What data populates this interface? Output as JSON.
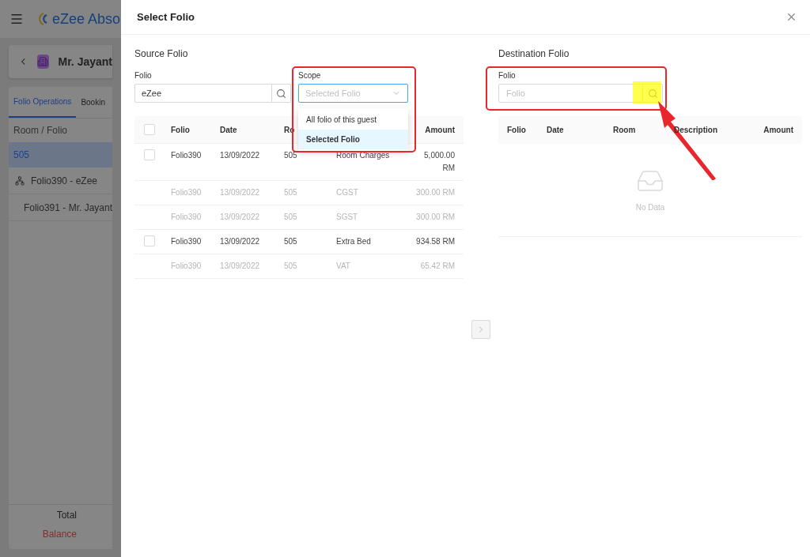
{
  "app": {
    "logo_text": "eZee Abso",
    "guest_name": "Mr. Jayant",
    "tabs": [
      {
        "label": "Folio Operations",
        "selected": true
      },
      {
        "label": "Bookin",
        "selected": false
      }
    ],
    "list_header": "Room / Folio",
    "rooms": [
      {
        "label": "505",
        "selected": true,
        "children": [
          {
            "label": "Folio390 - eZee",
            "kind": "linked"
          },
          {
            "label": "Folio391 - Mr. Jayant",
            "kind": "plain"
          }
        ]
      }
    ],
    "totals": [
      {
        "label": "Total",
        "kind": "normal"
      },
      {
        "label": "Balance",
        "kind": "alert"
      }
    ]
  },
  "dialog": {
    "title": "Select Folio",
    "source": {
      "heading": "Source Folio",
      "folio_field": {
        "label": "Folio",
        "value": "eZee"
      },
      "scope": {
        "label": "Scope",
        "placeholder": "Selected Folio",
        "expanded": true,
        "options": [
          {
            "label": "All folio of this guest",
            "selected": false
          },
          {
            "label": "Selected Folio",
            "selected": true
          }
        ]
      },
      "select_all_checked": false,
      "columns": {
        "folio": "Folio",
        "date": "Date",
        "room": "Ro",
        "amount": "Amount"
      },
      "rows": [
        {
          "folio": "Folio390",
          "date": "13/09/2022",
          "room": "505",
          "description": "Room Charges",
          "amount": "5,000.00 RM",
          "selectable": true,
          "checked": false
        },
        {
          "folio": "Folio390",
          "date": "13/09/2022",
          "room": "505",
          "description": "CGST",
          "amount": "300.00 RM",
          "selectable": false
        },
        {
          "folio": "Folio390",
          "date": "13/09/2022",
          "room": "505",
          "description": "SGST",
          "amount": "300.00 RM",
          "selectable": false
        },
        {
          "folio": "Folio390",
          "date": "13/09/2022",
          "room": "505",
          "description": "Extra Bed",
          "amount": "934.58 RM",
          "selectable": true,
          "checked": false
        },
        {
          "folio": "Folio390",
          "date": "13/09/2022",
          "room": "505",
          "description": "VAT",
          "amount": "65.42 RM",
          "selectable": false
        }
      ]
    },
    "transfer_disabled": true,
    "destination": {
      "heading": "Destination Folio",
      "folio_field": {
        "label": "Folio",
        "placeholder": "Folio"
      },
      "columns": {
        "folio": "Folio",
        "date": "Date",
        "room": "Room",
        "description": "Description",
        "amount": "Amount"
      },
      "empty_text": "No Data"
    }
  }
}
